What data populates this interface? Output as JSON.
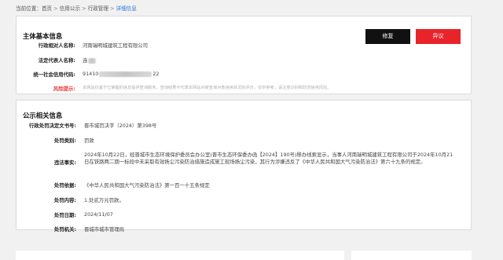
{
  "breadcrumb": {
    "prefix": "当前位置：",
    "items": [
      "首页",
      "信用公示",
      "行政管理"
    ],
    "current": "详细信息",
    "separator": ">"
  },
  "basic": {
    "title": "主体基本信息",
    "buttons": {
      "repair": "修复",
      "objection": "异议"
    },
    "fields": {
      "name_label": "行政相对人名称:",
      "name_value": "河南瑞明城建筑工程有限公司",
      "legal_label": "法定代表人名称:",
      "legal_value": "连",
      "code_label": "统一社会信用代码:",
      "code_prefix": "91410",
      "code_suffix": "22",
      "risk_label": "风险提示:",
      "risk_value": "本网站仅基于已掌握的信息提供查询服务，查询结果不代表本网站对被查询对象信用状况的评价，仅供参考，请注意识别和防范信用风险。"
    }
  },
  "publicity": {
    "title": "公示相关信息",
    "fields": [
      {
        "label": "行政处罚决定文书号:",
        "value": "晋市城罚决字（2024）第398号"
      },
      {
        "label": "处罚类别:",
        "value": "罚款"
      },
      {
        "label": "违法事实:",
        "value": "2024年10月22日，经晋城市生态环境保护委员会办公室(晋市生态环保委办函【2024】190号)移办线索显示，当事人河南瑞明城建筑工程有限公司于2024年10月21日在铁路两二期一标段中未采取有效扬尘污染防治措施造成施工现场扬尘污染，其行为涉嫌违反了《中华人民共和国大气污染防治法》第六十九条的规定。"
      },
      {
        "label": "处罚依据:",
        "value": "《中华人民共和国大气污染防治法》第一百一十五条规定"
      },
      {
        "label": "处罚内容:",
        "value": "1.处贰万元罚款。"
      },
      {
        "label": "处罚日期:",
        "value": "2024/11/07"
      },
      {
        "label": "处罚机关:",
        "value": "晋城市城市管理局"
      }
    ]
  }
}
